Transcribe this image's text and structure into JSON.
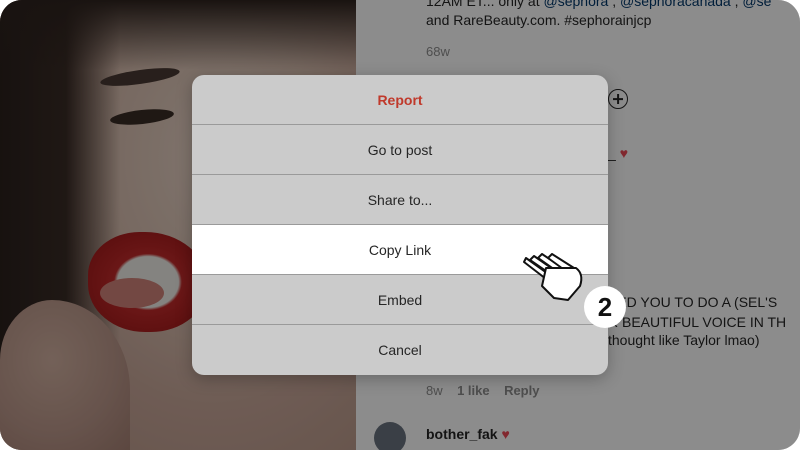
{
  "comments": {
    "line1": "12AM ET... only at",
    "mention1": "@sephora",
    "sep1": ",",
    "mention2": "@sephoracanada",
    "sep2": ",",
    "mention3": "@se",
    "line2": "and RareBeauty.com. #sephorainjcp",
    "time1": "68w",
    "partial_user": "_",
    "line_reply1": "EED YOU TO DO A (SEL'S",
    "line_reply2": "R BEAUTIFUL VOICE IN TH",
    "line_reply3": "thought like Taylor lmao)",
    "meta_time": "8w",
    "meta_likes": "1 like",
    "meta_reply": "Reply",
    "next_user": "bother_fak"
  },
  "menu": {
    "report": "Report",
    "go_to_post": "Go to post",
    "share_to": "Share to...",
    "copy_link": "Copy Link",
    "embed": "Embed",
    "cancel": "Cancel"
  },
  "step_badge": "2",
  "colors": {
    "danger": "#c0392b",
    "highlight": "#ffffff",
    "link": "#00376b"
  },
  "icons": {
    "add": "plus-circle-icon",
    "heart": "heart-icon",
    "cursor": "hand-pointer-icon"
  }
}
